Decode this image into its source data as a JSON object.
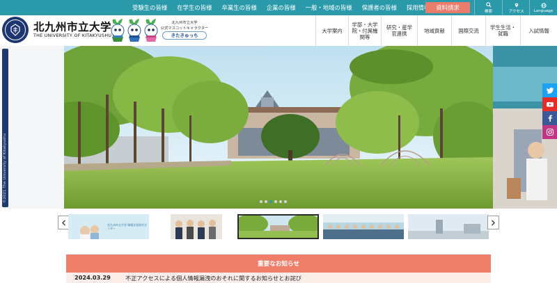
{
  "topbar": {
    "links": [
      "受験生の皆様",
      "在学生の皆様",
      "卒業生の皆様",
      "企業の皆様",
      "一般・地域の皆様",
      "保護者の皆様",
      "採用情報"
    ],
    "request_button": "資料請求",
    "search_label": "検索",
    "access_label": "アクセス",
    "language_label": "Language"
  },
  "header": {
    "logo_jp": "北九州市立大学",
    "logo_en": "THE UNIVERSITY OF KITAKYUSHU",
    "mascot_line1": "北九州市立大学",
    "mascot_line2": "公式マスコットキャラクター",
    "mascot_name": "きたきゅっち",
    "nav": [
      "大学案内",
      "学部・大学院・付属機関等",
      "研究・産学官連携",
      "地域貢献",
      "国際交流",
      "学生生活・就職",
      "入試情報"
    ]
  },
  "hero": {
    "copyright": "©2021 The University of Kitakyushu",
    "slide_count": 6,
    "active_slide": 3
  },
  "thumbs": {
    "thumb1_text": "北九州市立大学 情報文化研究センター"
  },
  "notice": {
    "heading": "重要なお知らせ",
    "date": "2024.03.29",
    "text": "不正アクセスによる個人情報漏洩のおそれに関するお知らせとお詫び"
  },
  "colors": {
    "teal": "#2a9aab",
    "coral": "#ea7d6b",
    "navy": "#1d3570"
  }
}
